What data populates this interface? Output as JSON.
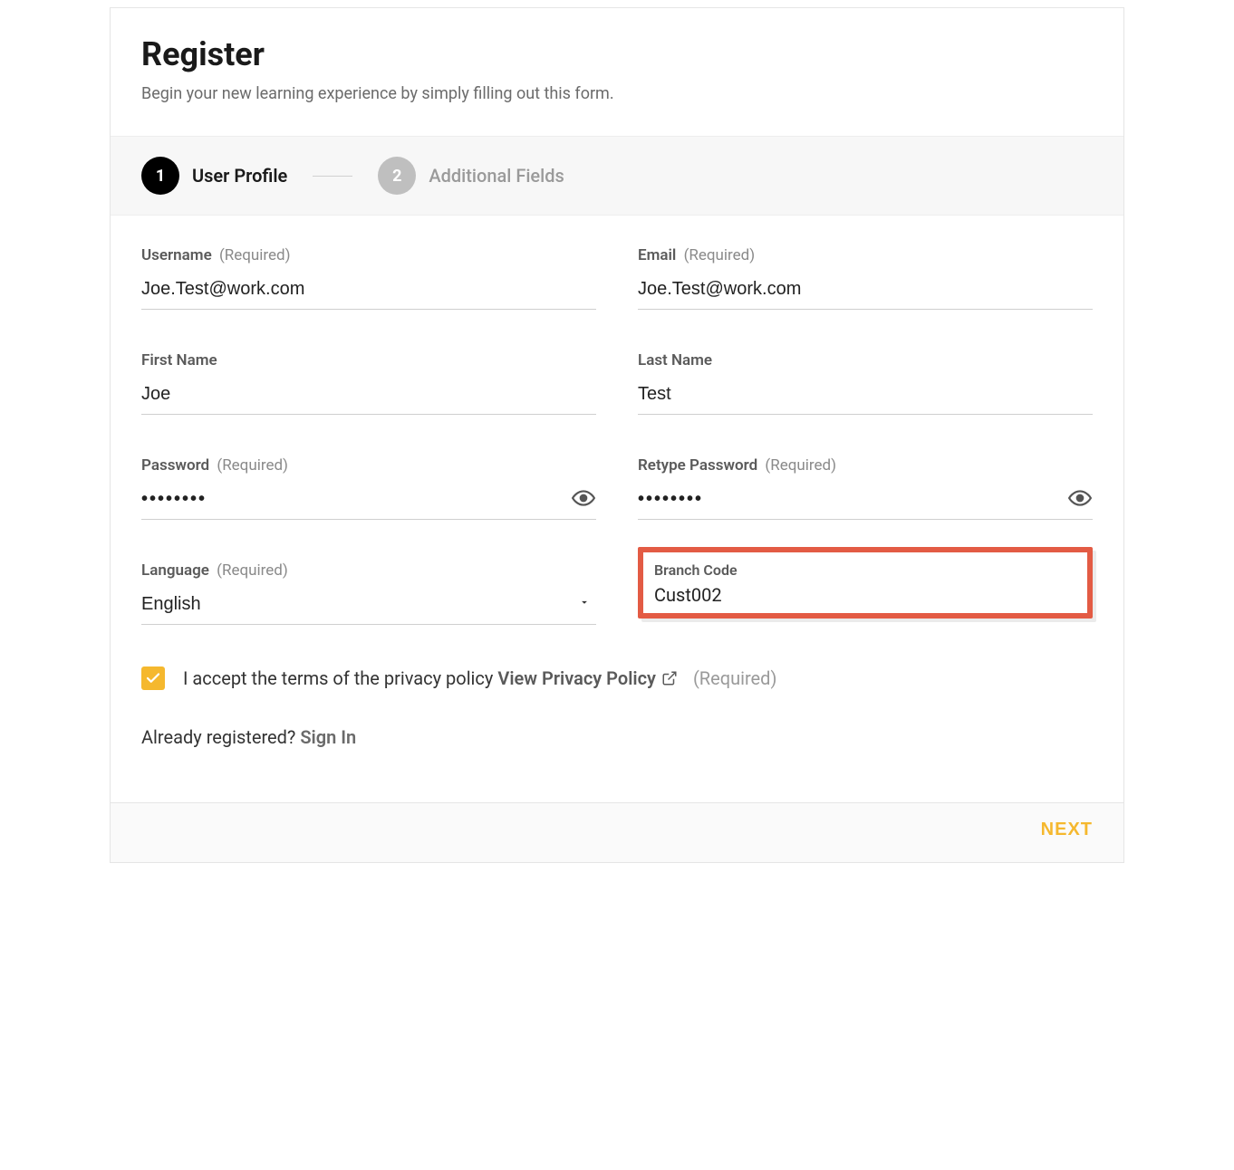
{
  "header": {
    "title": "Register",
    "subtitle": "Begin your new learning experience by simply filling out this form."
  },
  "stepper": {
    "step1_num": "1",
    "step1_label": "User Profile",
    "step2_num": "2",
    "step2_label": "Additional Fields"
  },
  "fields": {
    "username": {
      "label": "Username",
      "required": "(Required)",
      "value": "Joe.Test@work.com"
    },
    "email": {
      "label": "Email",
      "required": "(Required)",
      "value": "Joe.Test@work.com"
    },
    "first_name": {
      "label": "First Name",
      "value": "Joe"
    },
    "last_name": {
      "label": "Last Name",
      "value": "Test"
    },
    "password": {
      "label": "Password",
      "required": "(Required)",
      "value": "••••••••"
    },
    "retype_password": {
      "label": "Retype Password",
      "required": "(Required)",
      "value": "••••••••"
    },
    "language": {
      "label": "Language",
      "required": "(Required)",
      "value": "English"
    },
    "branch_code": {
      "label": "Branch Code",
      "value": "Cust002"
    }
  },
  "privacy": {
    "text": "I accept the terms of the privacy policy",
    "link": "View Privacy Policy",
    "required": "(Required)"
  },
  "signin": {
    "prompt": "Already registered? ",
    "link": "Sign In"
  },
  "footer": {
    "next": "NEXT"
  },
  "colors": {
    "accent": "#f5b82e",
    "highlight_border": "#e35b44"
  }
}
